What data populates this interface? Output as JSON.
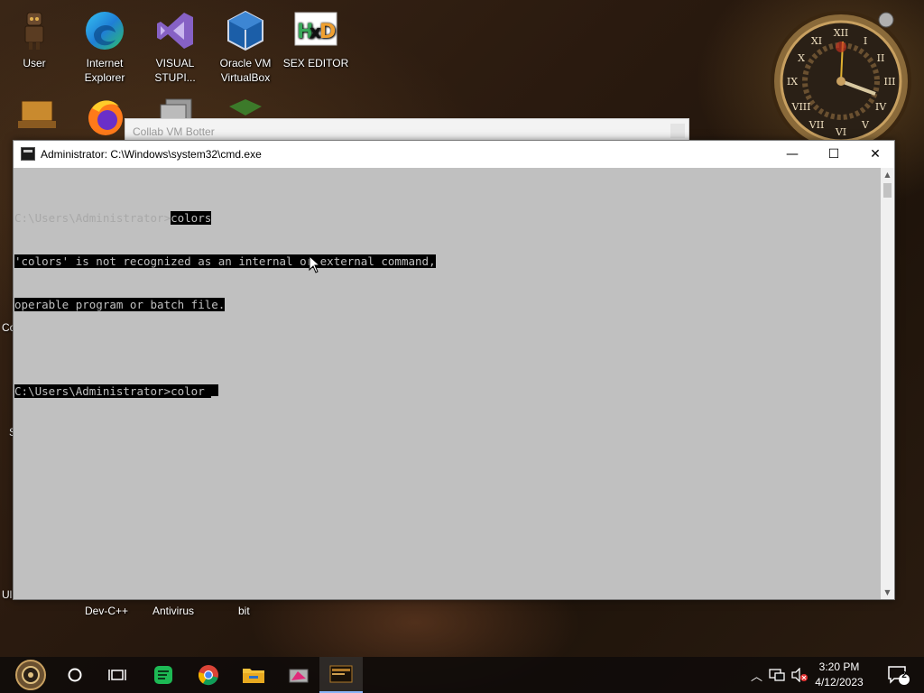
{
  "desktop": {
    "icons": [
      {
        "label": "User"
      },
      {
        "label": "Internet Explorer"
      },
      {
        "label": "VISUAL STUPI..."
      },
      {
        "label": "Oracle VM VirtualBox"
      },
      {
        "label": "SEX EDITOR"
      }
    ],
    "bottom_labels": [
      "Dev-C++",
      "Antivirus",
      "bit"
    ],
    "edge_fragments": [
      "Co",
      "S",
      "Ul"
    ]
  },
  "background_window": {
    "title": "Collab VM Botter"
  },
  "cmd_window": {
    "title": "Administrator: C:\\Windows\\system32\\cmd.exe",
    "controls": {
      "minimize": "—",
      "maximize": "☐",
      "close": "✕"
    },
    "console": {
      "prompt1": "C:\\Users\\Administrator>",
      "command1": "colors",
      "error_line1": "'colors' is not recognized as an internal or external command,",
      "error_line2": "operable program or batch file.",
      "prompt2": "C:\\Users\\Administrator>",
      "command2": "color "
    },
    "colors": {
      "console_bg": "#c0c0c0",
      "highlight_bg": "#000000"
    }
  },
  "taskbar": {
    "time": "3:20 PM",
    "date": "4/12/2023",
    "notification_count": "2",
    "items": [
      "start-button",
      "cortana-circle",
      "task-view",
      "app-green",
      "chrome",
      "file-explorer",
      "app-pink",
      "cmd-active"
    ]
  }
}
